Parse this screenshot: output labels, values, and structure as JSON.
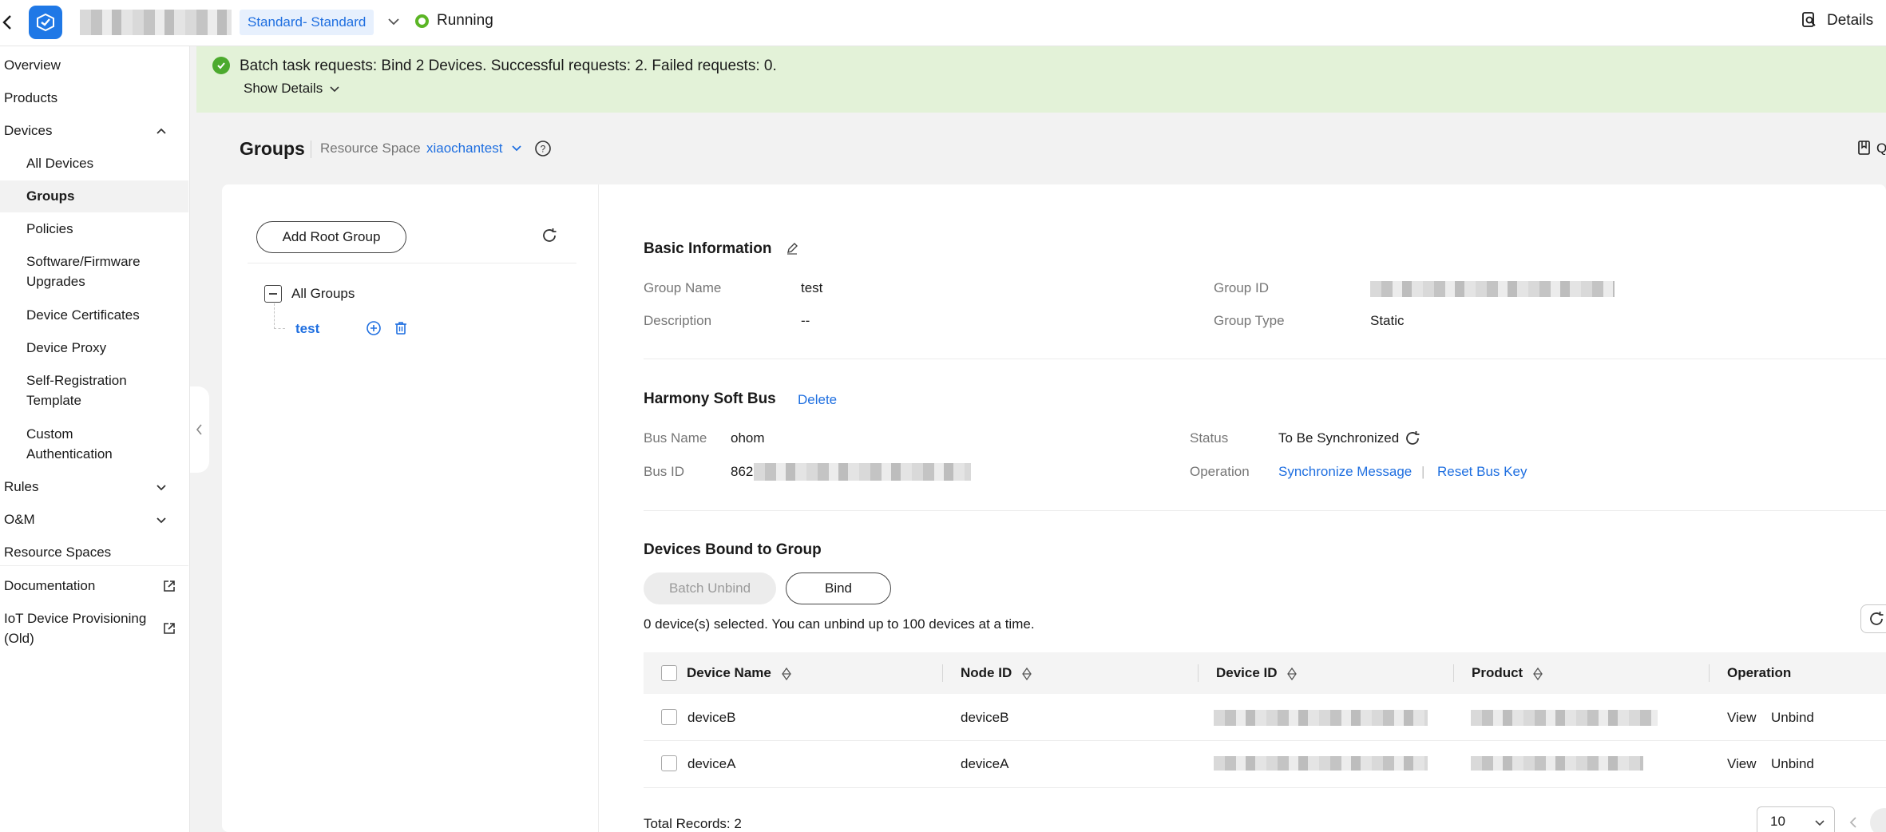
{
  "topbar": {
    "edition_badge": "Standard- Standard",
    "status": "Running",
    "details_label": "Details"
  },
  "sidebar": {
    "items": [
      {
        "label": "Overview"
      },
      {
        "label": "Products"
      },
      {
        "label": "Devices"
      },
      {
        "label": "All Devices"
      },
      {
        "label": "Groups"
      },
      {
        "label": "Policies"
      },
      {
        "label": "Software/Firmware Upgrades"
      },
      {
        "label": "Device Certificates"
      },
      {
        "label": "Device Proxy"
      },
      {
        "label": "Self-Registration Template"
      },
      {
        "label": "Custom Authentication"
      },
      {
        "label": "Rules"
      },
      {
        "label": "O&M"
      },
      {
        "label": "Resource Spaces"
      },
      {
        "label": "Documentation"
      },
      {
        "label": "IoT Device Provisioning (Old)"
      }
    ]
  },
  "banner": {
    "message": "Batch task requests: Bind 2 Devices. Successful requests: 2. Failed requests: 0.",
    "show_details": "Show Details"
  },
  "header": {
    "title": "Groups",
    "resource_space_label": "Resource Space",
    "resource_space_value": "xiaochantest",
    "right_action_partial": "Q"
  },
  "tree": {
    "add_root_label": "Add Root Group",
    "root_label": "All Groups",
    "child_label": "test"
  },
  "basic_info": {
    "title": "Basic Information",
    "group_name_label": "Group Name",
    "group_name_value": "test",
    "description_label": "Description",
    "description_value": "--",
    "group_id_label": "Group ID",
    "group_type_label": "Group Type",
    "group_type_value": "Static"
  },
  "soft_bus": {
    "title": "Harmony Soft Bus",
    "delete_label": "Delete",
    "bus_name_label": "Bus Name",
    "bus_name_value": "ohom",
    "bus_id_label": "Bus ID",
    "bus_id_prefix": "862",
    "status_label": "Status",
    "status_value": "To Be Synchronized",
    "operation_label": "Operation",
    "sync_label": "Synchronize Message",
    "separator": "|",
    "reset_label": "Reset Bus Key"
  },
  "devices": {
    "title": "Devices Bound to Group",
    "batch_unbind_label": "Batch Unbind",
    "bind_label": "Bind",
    "selection_note": "0 device(s) selected. You can unbind up to 100 devices at a time.",
    "columns": [
      "Device Name",
      "Node ID",
      "Device ID",
      "Product",
      "Operation"
    ],
    "rows": [
      {
        "name": "deviceB",
        "node_id": "deviceB",
        "view": "View",
        "unbind": "Unbind"
      },
      {
        "name": "deviceA",
        "node_id": "deviceA",
        "view": "View",
        "unbind": "Unbind"
      }
    ],
    "total_records": "Total Records: 2",
    "page_size": "10"
  },
  "colors": {
    "accent": "#1f6fe0",
    "success": "#4caa2e",
    "banner_bg": "#e3f2d8"
  }
}
